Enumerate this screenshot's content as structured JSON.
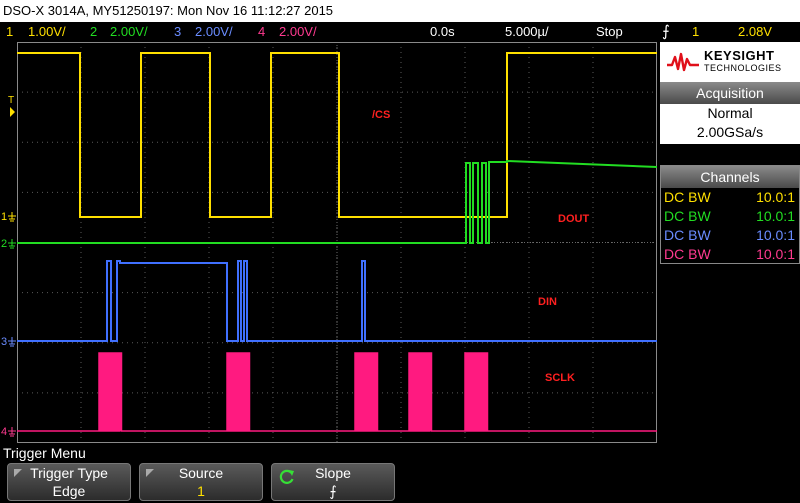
{
  "titlebar": {
    "text": "DSO-X 3014A, MY51250197: Mon Nov 16 11:12:27 2015"
  },
  "statusbar": {
    "ch1": {
      "num": "1",
      "scale": "1.00V/"
    },
    "ch2": {
      "num": "2",
      "scale": "2.00V/"
    },
    "ch3": {
      "num": "3",
      "scale": "2.00V/"
    },
    "ch4": {
      "num": "4",
      "scale": "2.00V/"
    },
    "time_delay": "0.0s",
    "time_scale": "5.000µ/",
    "run_state": "Stop",
    "trigger_source": "1",
    "trigger_level": "2.08V"
  },
  "colors": {
    "ch1": "#ffe000",
    "ch2": "#22dd22",
    "ch3": "#4070ff",
    "ch4": "#ff1a80"
  },
  "logo": {
    "brand": "KEYSIGHT",
    "sub": "TECHNOLOGIES"
  },
  "acquisition": {
    "title": "Acquisition",
    "mode": "Normal",
    "rate": "2.00GSa/s"
  },
  "channels": {
    "title": "Channels",
    "rows": [
      {
        "coupling": "DC BW",
        "probe": "10.0:1"
      },
      {
        "coupling": "DC BW",
        "probe": "10.0:1"
      },
      {
        "coupling": "DC BW",
        "probe": "10.0:1"
      },
      {
        "coupling": "DC BW",
        "probe": "10.0:1"
      }
    ]
  },
  "annotations": {
    "cs": "/CS",
    "dout": "DOUT",
    "din": "DIN",
    "sclk": "SCLK"
  },
  "markers": {
    "ch1": "1",
    "ch2": "2",
    "ch3": "3",
    "ch4": "4",
    "trigger": "T"
  },
  "softkeys": {
    "menu_title": "Trigger Menu",
    "trigger_type": {
      "label": "Trigger Type",
      "value": "Edge"
    },
    "source": {
      "label": "Source",
      "value": "1"
    },
    "slope": {
      "label": "Slope",
      "value": "⨍"
    }
  }
}
